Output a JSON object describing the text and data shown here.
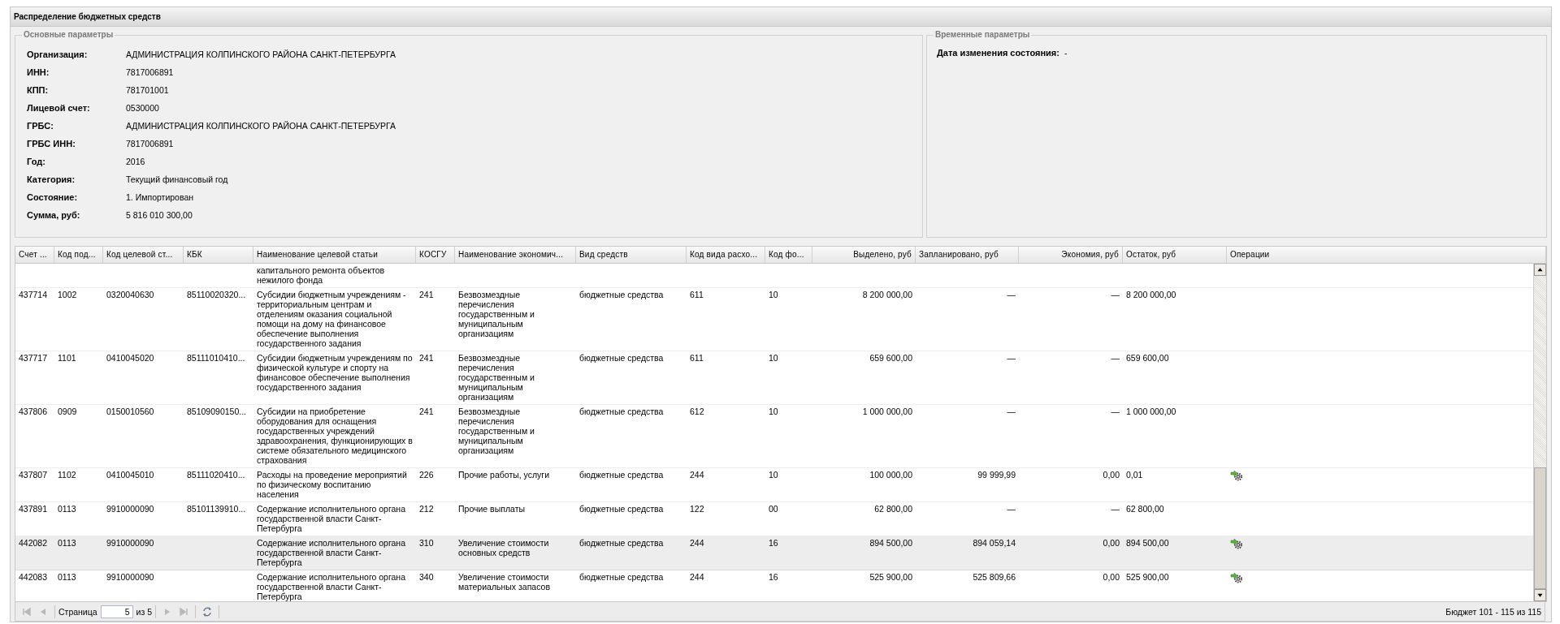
{
  "window": {
    "title": "Распределение бюджетных средств"
  },
  "main_params": {
    "legend": "Основные параметры",
    "fields": [
      {
        "label": "Организация:",
        "value": "АДМИНИСТРАЦИЯ КОЛПИНСКОГО РАЙОНА САНКТ-ПЕТЕРБУРГА"
      },
      {
        "label": "ИНН:",
        "value": "7817006891"
      },
      {
        "label": "КПП:",
        "value": "781701001"
      },
      {
        "label": "Лицевой счет:",
        "value": "0530000"
      },
      {
        "label": "ГРБС:",
        "value": "АДМИНИСТРАЦИЯ КОЛПИНСКОГО РАЙОНА САНКТ-ПЕТЕРБУРГА"
      },
      {
        "label": "ГРБС ИНН:",
        "value": "7817006891"
      },
      {
        "label": "Год:",
        "value": "2016"
      },
      {
        "label": "Категория:",
        "value": "Текущий финансовый год"
      },
      {
        "label": "Состояние:",
        "value": "1. Импортирован"
      },
      {
        "label": "Сумма, руб:",
        "value": "5 816 010 300,00"
      }
    ]
  },
  "time_params": {
    "legend": "Временные параметры",
    "fields": [
      {
        "label": "Дата изменения состояния:",
        "value": "-"
      }
    ]
  },
  "table": {
    "columns": [
      "Счет ...",
      "Код под...",
      "Код целевой ст...",
      "КБК",
      "Наименование целевой статьи",
      "КОСГУ",
      "Наименование экономич...",
      "Вид средств",
      "Код вида расхо...",
      "Код фо...",
      "Выделено, руб",
      "Запланировано, руб",
      "Экономия, руб",
      "Остаток, руб",
      "Операции"
    ],
    "rows": [
      {
        "selected": false,
        "action_icon": false,
        "cells": [
          null,
          null,
          null,
          null,
          "капитального ремонта объектов нежилого фонда",
          null,
          null,
          null,
          null,
          null,
          null,
          null,
          null,
          null
        ]
      },
      {
        "selected": false,
        "action_icon": false,
        "cells": [
          "437714",
          "1002",
          "0320040630",
          "85110020320...",
          "Субсидии бюджетным учреждениям - территориальным центрам и отделениям оказания социальной помощи на дому на финансовое обеспечение выполнения государственного задания",
          "241",
          "Безвозмездные перечисления государственным и муниципальным организациям",
          "бюджетные средства",
          "611",
          "10",
          "8 200 000,00",
          "—",
          "—",
          "8 200 000,00"
        ]
      },
      {
        "selected": false,
        "action_icon": false,
        "cells": [
          "437717",
          "1101",
          "0410045020",
          "85111010410...",
          "Субсидии бюджетным учреждениям по физической культуре и спорту на финансовое обеспечение выполнения государственного задания",
          "241",
          "Безвозмездные перечисления государственным и муниципальным организациям",
          "бюджетные средства",
          "611",
          "10",
          "659 600,00",
          "—",
          "—",
          "659 600,00"
        ]
      },
      {
        "selected": false,
        "action_icon": false,
        "cells": [
          "437806",
          "0909",
          "0150010560",
          "85109090150...",
          "Субсидии на приобретение оборудования для оснащения государственных учреждений здравоохранения, функционирующих в системе обязательного медицинского страхования",
          "241",
          "Безвозмездные перечисления государственным и муниципальным организациям",
          "бюджетные средства",
          "612",
          "10",
          "1 000 000,00",
          "—",
          "—",
          "1 000 000,00"
        ]
      },
      {
        "selected": false,
        "action_icon": true,
        "cells": [
          "437807",
          "1102",
          "0410045010",
          "85111020410...",
          "Расходы на проведение мероприятий по физическому воспитанию населения",
          "226",
          "Прочие работы, услуги",
          "бюджетные средства",
          "244",
          "10",
          "100 000,00",
          "99 999,99",
          "0,00",
          "0,01"
        ]
      },
      {
        "selected": false,
        "action_icon": false,
        "cells": [
          "437891",
          "0113",
          "9910000090",
          "85101139910...",
          "Содержание исполнительного органа государственной власти Санкт-Петербурга",
          "212",
          "Прочие выплаты",
          "бюджетные средства",
          "122",
          "00",
          "62 800,00",
          "—",
          "—",
          "62 800,00"
        ]
      },
      {
        "selected": true,
        "action_icon": true,
        "cells": [
          "442082",
          "0113",
          "9910000090",
          null,
          "Содержание исполнительного органа государственной власти Санкт-Петербурга",
          "310",
          "Увеличение стоимости основных средств",
          "бюджетные средства",
          "244",
          "16",
          "894 500,00",
          "894 059,14",
          "0,00",
          "894 500,00"
        ]
      },
      {
        "selected": false,
        "action_icon": true,
        "cells": [
          "442083",
          "0113",
          "9910000090",
          null,
          "Содержание исполнительного органа государственной власти Санкт-Петербурга",
          "340",
          "Увеличение стоимости материальных запасов",
          "бюджетные средства",
          "244",
          "16",
          "525 900,00",
          "525 809,66",
          "0,00",
          "525 900,00"
        ]
      }
    ]
  },
  "pager": {
    "buttons": [
      {
        "kind": "first",
        "disabled": true
      },
      {
        "kind": "prev",
        "disabled": true
      },
      {
        "kind": "page"
      },
      {
        "kind": "next",
        "disabled": true
      },
      {
        "kind": "last",
        "disabled": true
      },
      {
        "kind": "refresh",
        "disabled": false
      }
    ],
    "page_label": "Страница",
    "page": "5",
    "of": "из 5",
    "summary": "Бюджет 101 - 115 из 115"
  }
}
